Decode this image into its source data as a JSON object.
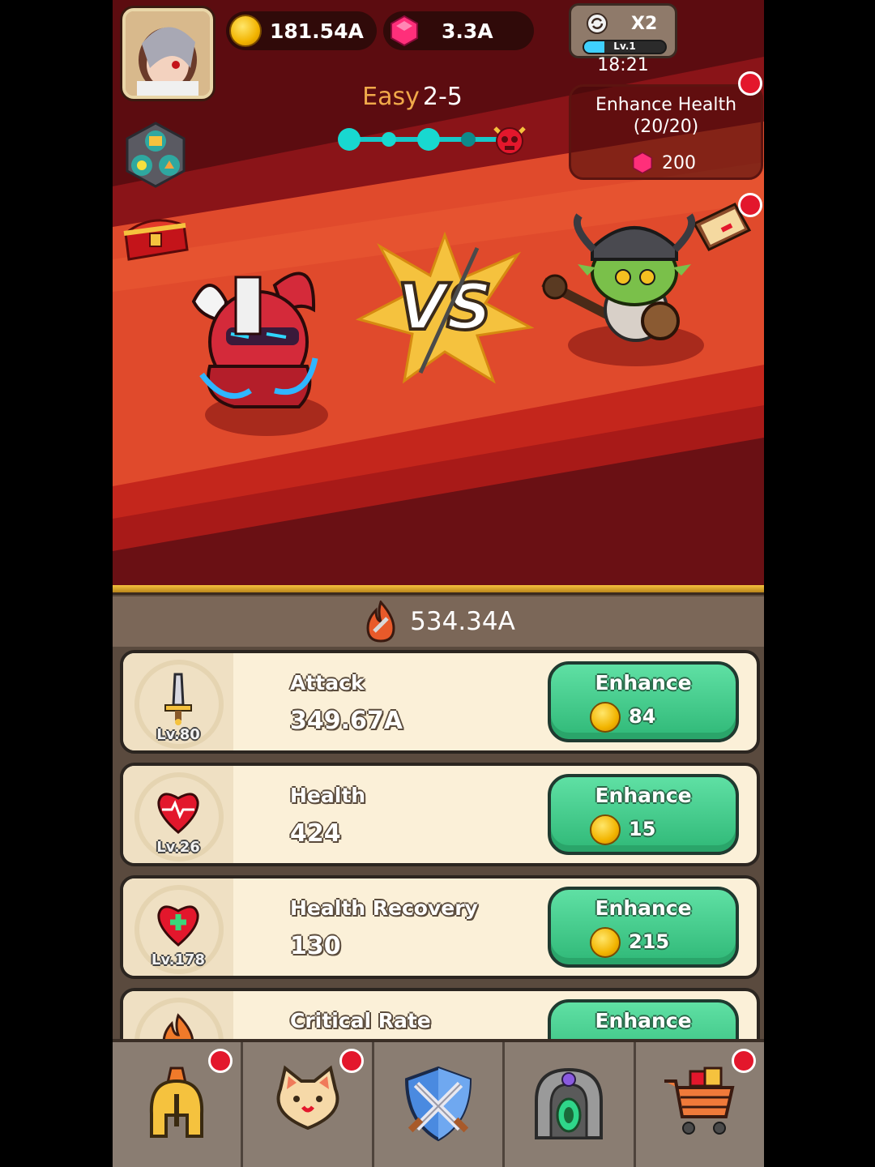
{
  "currency": {
    "gold": "181.54A",
    "gems": "3.3A"
  },
  "speed": {
    "multiplier": "X2",
    "level": "Lv.1",
    "progress": 0.25,
    "timer": "18:21"
  },
  "stage": {
    "difficulty": "Easy",
    "number": "2-5",
    "checkpoints_total": 5,
    "checkpoints_reached": 3
  },
  "quest": {
    "title": "Enhance Health",
    "progress": "(20/20)",
    "reward": "200"
  },
  "power": "534.34A",
  "stats": [
    {
      "name": "Attack",
      "value": "349.67A",
      "level": "Lv.80",
      "button": "Enhance",
      "cost": "84",
      "icon": "sword-icon"
    },
    {
      "name": "Health",
      "value": "424",
      "level": "Lv.26",
      "button": "Enhance",
      "cost": "15",
      "icon": "heart-pulse-icon"
    },
    {
      "name": "Health Recovery",
      "value": "130",
      "level": "Lv.178",
      "button": "Enhance",
      "cost": "215",
      "icon": "heart-plus-icon"
    },
    {
      "name": "Critical Rate",
      "value": "",
      "level": "",
      "button": "Enhance",
      "cost": "",
      "icon": "flame-icon"
    }
  ],
  "nav": [
    {
      "name": "hero",
      "icon": "helmet-icon",
      "badge": true
    },
    {
      "name": "pets",
      "icon": "cat-icon",
      "badge": true
    },
    {
      "name": "battle",
      "icon": "crossed-swords-shield-icon",
      "badge": false
    },
    {
      "name": "dungeon",
      "icon": "portal-icon",
      "badge": false
    },
    {
      "name": "shop",
      "icon": "shopping-cart-icon",
      "badge": true
    }
  ],
  "colors": {
    "accent": "#2fb877",
    "badge": "#e3172c",
    "gold_bar": "#f5c23e",
    "scene_red": "#e04a2c"
  }
}
